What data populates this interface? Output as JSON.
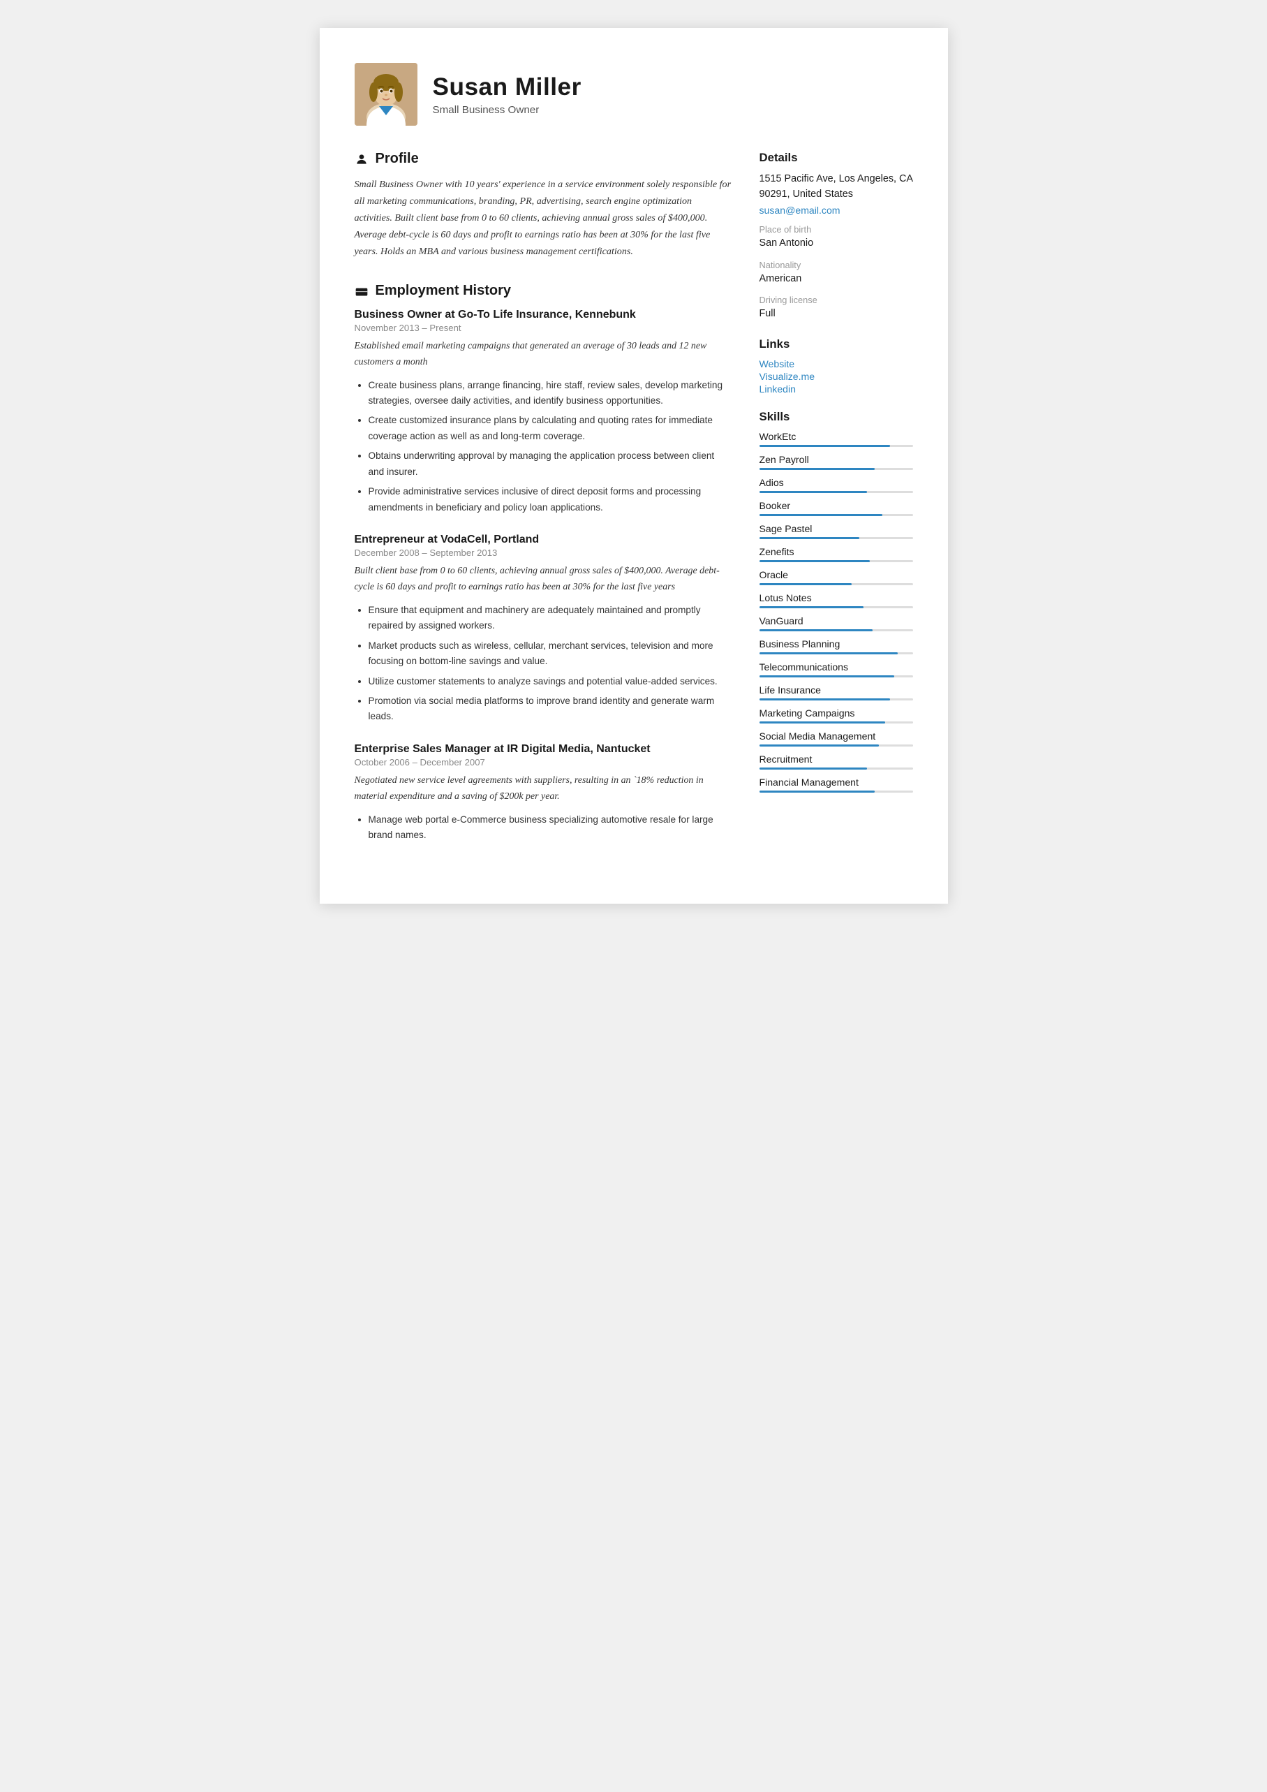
{
  "header": {
    "name": "Susan Miller",
    "subtitle": "Small Business Owner",
    "avatar_alt": "Susan Miller photo"
  },
  "profile": {
    "section_title": "Profile",
    "text": "Small Business Owner with 10 years' experience in a service environment solely responsible for all marketing communications, branding, PR, advertising, search engine optimization activities. Built client base from 0 to 60 clients, achieving annual gross sales of $400,000. Average debt-cycle is 60 days and profit to earnings ratio has been at 30% for the last five years. Holds an MBA and various business management certifications."
  },
  "employment": {
    "section_title": "Employment History",
    "jobs": [
      {
        "title": "Business Owner at Go-To Life Insurance, Kennebunk",
        "dates": "November 2013 – Present",
        "summary": "Established email marketing campaigns that generated an average of 30 leads and 12 new customers a month",
        "bullets": [
          "Create business plans, arrange financing, hire staff, review sales, develop marketing strategies, oversee daily activities, and identify business opportunities.",
          "Create customized insurance plans by calculating and quoting rates for immediate coverage action as well as and long-term coverage.",
          "Obtains underwriting approval by managing the application process between client and insurer.",
          "Provide administrative services inclusive of direct deposit forms and processing amendments in beneficiary and policy loan applications."
        ]
      },
      {
        "title": "Entrepreneur at VodaCell, Portland",
        "dates": "December 2008 – September 2013",
        "summary": "Built client base from 0 to 60 clients, achieving annual gross sales of $400,000. Average debt-cycle is 60 days and profit to earnings ratio has been at 30% for the last five years",
        "bullets": [
          "Ensure that equipment and machinery are adequately maintained and promptly repaired by assigned workers.",
          "Market products such as wireless, cellular, merchant services, television and more focusing on bottom-line savings and value.",
          "Utilize customer statements to analyze savings and potential value-added services.",
          "Promotion via social media platforms to improve brand identity and generate warm leads."
        ]
      },
      {
        "title": "Enterprise Sales Manager at IR Digital Media, Nantucket",
        "dates": "October 2006 – December 2007",
        "summary": "Negotiated new service level agreements with suppliers, resulting in an `18% reduction in material expenditure and a saving of $200k per year.",
        "bullets": [
          "Manage web portal e-Commerce business specializing automotive resale for large brand names."
        ]
      }
    ]
  },
  "details": {
    "section_title": "Details",
    "address": "1515 Pacific Ave, Los Angeles, CA 90291, United States",
    "email": "susan@email.com",
    "place_of_birth_label": "Place of birth",
    "place_of_birth": "San Antonio",
    "nationality_label": "Nationality",
    "nationality": "American",
    "driving_license_label": "Driving license",
    "driving_license": "Full"
  },
  "links": {
    "section_title": "Links",
    "items": [
      {
        "label": "Website",
        "url": "#"
      },
      {
        "label": "Visualize.me",
        "url": "#"
      },
      {
        "label": "Linkedin",
        "url": "#"
      }
    ]
  },
  "skills": {
    "section_title": "Skills",
    "items": [
      {
        "name": "WorkEtc",
        "level": 85
      },
      {
        "name": "Zen Payroll",
        "level": 75
      },
      {
        "name": "Adios",
        "level": 70
      },
      {
        "name": "Booker",
        "level": 80
      },
      {
        "name": "Sage Pastel",
        "level": 65
      },
      {
        "name": "Zenefits",
        "level": 72
      },
      {
        "name": "Oracle",
        "level": 60
      },
      {
        "name": "Lotus Notes",
        "level": 68
      },
      {
        "name": "VanGuard",
        "level": 74
      },
      {
        "name": "Business Planning",
        "level": 90
      },
      {
        "name": "Telecommunications",
        "level": 88
      },
      {
        "name": "Life Insurance",
        "level": 85
      },
      {
        "name": "Marketing Campaigns",
        "level": 82
      },
      {
        "name": "Social Media Management",
        "level": 78
      },
      {
        "name": "Recruitment",
        "level": 70
      },
      {
        "name": "Financial Management",
        "level": 75
      }
    ]
  },
  "icons": {
    "profile": "person",
    "employment": "briefcase"
  }
}
